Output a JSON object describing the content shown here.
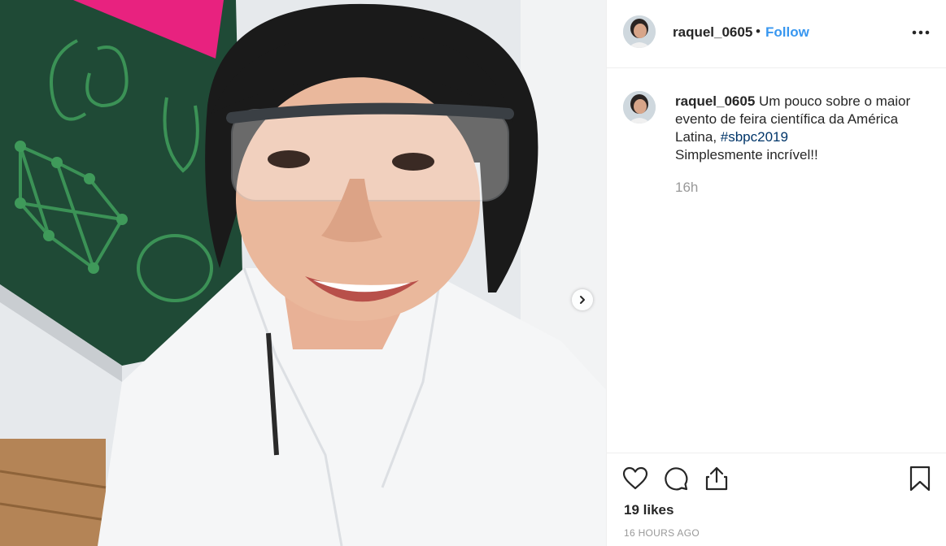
{
  "post": {
    "username": "raquel_0605",
    "follow_label": "Follow",
    "separator": "•",
    "caption": {
      "text_before_tag": "Um pouco sobre o maior evento de feira científica da América Latina, ",
      "hashtag": "#sbpc2019",
      "line2": "Simplesmente incrível!!"
    },
    "time_short": "16h",
    "likes": "19 likes",
    "time_full": "16 HOURS AGO"
  },
  "icons": {
    "more": "more-options-icon",
    "next": "chevron-right-icon",
    "like": "heart-icon",
    "comment": "comment-icon",
    "share": "share-icon",
    "save": "bookmark-icon"
  },
  "colors": {
    "link_blue": "#3897f0",
    "hashtag_blue": "#003569",
    "text": "#262626",
    "muted": "#999999",
    "border": "#efefef"
  }
}
